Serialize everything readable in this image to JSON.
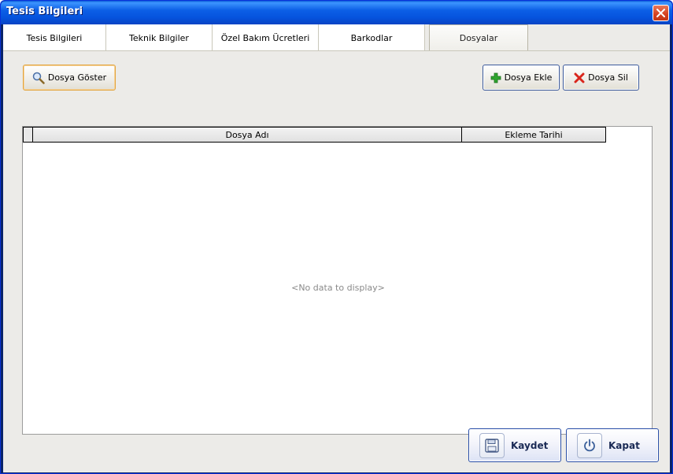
{
  "window": {
    "title": "Tesis Bilgileri"
  },
  "tabs": [
    {
      "label": "Tesis Bilgileri"
    },
    {
      "label": "Teknik Bilgiler"
    },
    {
      "label": "Özel Bakım Ücretleri"
    },
    {
      "label": "Barkodlar"
    },
    {
      "label": "Dosyalar"
    }
  ],
  "active_tab": "Dosyalar",
  "toolbar": {
    "show_file_label": "Dosya Göster",
    "add_file_label": "Dosya Ekle",
    "delete_file_label": "Dosya Sil"
  },
  "grid": {
    "columns": [
      "Dosya Adı",
      "Ekleme Tarihi"
    ],
    "empty_text": "<No data to display>"
  },
  "footer": {
    "save_label": "Kaydet",
    "close_label": "Kapat"
  },
  "colors": {
    "titlebar": "#0c5fe6",
    "client_bg": "#ecebe8",
    "close_button": "#d5411f",
    "add_icon": "#2fa52f",
    "delete_icon": "#d9261c"
  }
}
